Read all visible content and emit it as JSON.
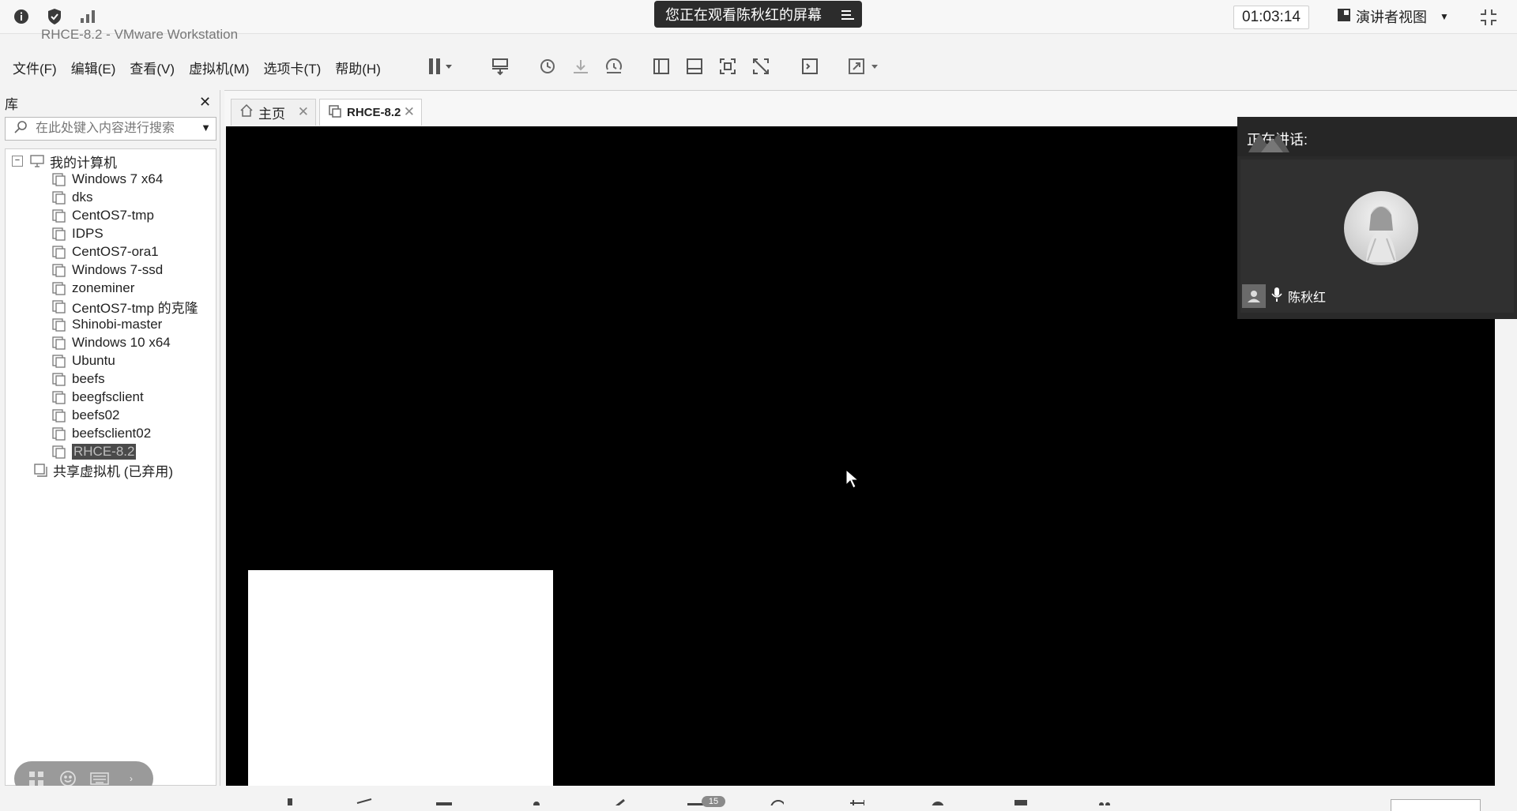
{
  "meeting": {
    "share_banner": "您正在观看陈秋红的屏幕",
    "timer": "01:03:14",
    "presenter_view": "演讲者视图"
  },
  "window": {
    "title": "RHCE-8.2 - VMware Workstation"
  },
  "menu": {
    "file": "文件(F)",
    "edit": "编辑(E)",
    "view": "查看(V)",
    "vm": "虚拟机(M)",
    "tabs": "选项卡(T)",
    "help": "帮助(H)"
  },
  "library": {
    "title": "库",
    "search_placeholder": "在此处键入内容进行搜索",
    "root": "我的计算机",
    "items": [
      "Windows 7 x64",
      "dks",
      "CentOS7-tmp",
      "IDPS",
      "CentOS7-ora1",
      "Windows 7-ssd",
      "zoneminer",
      "CentOS7-tmp 的克隆",
      "Shinobi-master",
      "Windows 10 x64",
      "Ubuntu",
      "beefs",
      "beegfsclient",
      "beefs02",
      "beefsclient02",
      "RHCE-8.2"
    ],
    "selected": "RHCE-8.2",
    "shared": "共享虚拟机 (已弃用)"
  },
  "tabs": {
    "home": "主页",
    "active": "RHCE-8.2"
  },
  "speaker": {
    "header": "正在讲话:",
    "name": "陈秋红"
  },
  "bottom": {
    "badge": "15"
  },
  "colors": {
    "banner_bg": "#2c2c2c",
    "vm_display_bg": "#000000",
    "speaker_panel_bg": "#2a2a2a",
    "selection_bg": "#4a4a4a"
  },
  "icons": [
    "info-icon",
    "shield-icon",
    "signal-icon",
    "share-menu-icon",
    "presenter-view-icon",
    "exit-fullscreen-icon",
    "pause-icon",
    "send-keys-icon",
    "snapshot-icon",
    "revert-snapshot-icon",
    "snapshot-manager-icon",
    "show-library-icon",
    "thumbnail-bar-icon",
    "fullscreen-icon",
    "unity-icon",
    "console-icon",
    "stretch-guest-icon",
    "home-icon",
    "vm-icon",
    "computer-icon",
    "mic-icon",
    "user-icon",
    "mouse-cursor-icon"
  ]
}
